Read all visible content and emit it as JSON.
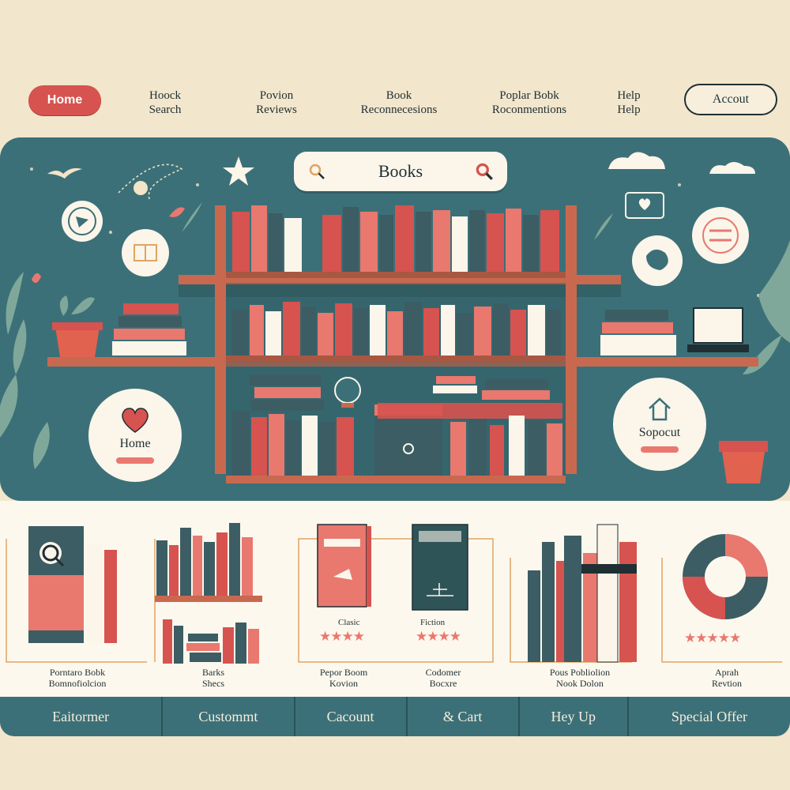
{
  "nav": {
    "home": "Home",
    "items": [
      {
        "line1": "Hoock",
        "line2": "Search"
      },
      {
        "line1": "Povion",
        "line2": "Reviews"
      },
      {
        "line1": "Book",
        "line2": "Reconnecesions"
      },
      {
        "line1": "Poplar Bobk",
        "line2": "Roconmentions"
      },
      {
        "line1": "Help",
        "line2": "Help"
      }
    ],
    "account": "Accout"
  },
  "hero": {
    "search_text": "Books",
    "left_circle_label": "Home",
    "right_circle_label": "Sopocut"
  },
  "cards": [
    {
      "caption1": "Porntaro Bobk",
      "caption2": "Bomnofiolcion"
    },
    {
      "caption1": "Barks",
      "caption2": "Shecs"
    },
    {
      "caption1": "Pepor Boom",
      "caption2": "Kovion",
      "book_label": "Clasic",
      "stars": "★★★★"
    },
    {
      "caption1": "Codomer",
      "caption2": "Bocxre",
      "book_label": "Fiction",
      "stars": "★★★★"
    },
    {
      "caption1": "Pous Pobliolion",
      "caption2": "Nook Dolon"
    },
    {
      "caption1": "Aprah",
      "caption2": "Revtion",
      "stars": "★★★★★"
    }
  ],
  "bottom_bar": [
    "Eaitormer",
    "Custommt",
    "Cacount",
    "&  Cart",
    "Hey Up",
    "Special Offer"
  ],
  "colors": {
    "background": "#f2e6cc",
    "teal": "#3c7078",
    "coral": "#d6534f",
    "cream": "#fbf5ea",
    "dark": "#1f2f33"
  }
}
